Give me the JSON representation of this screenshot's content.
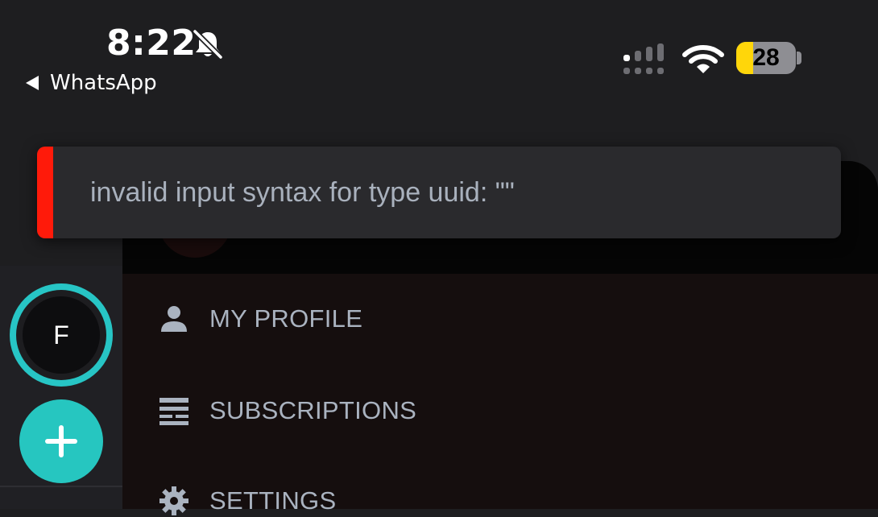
{
  "status_bar": {
    "time": "8:22",
    "back_label": "WhatsApp",
    "battery_level": "28",
    "battery_fraction": 0.28,
    "icons": [
      "bell-muted-icon",
      "signal-icon",
      "wifi-icon",
      "battery-icon"
    ]
  },
  "toast": {
    "message": "invalid input syntax for type uuid: \"\"",
    "accent_color": "#ff1a0a"
  },
  "rail": {
    "avatar_initial": "F",
    "ring_color": "#27c5c5",
    "add_button_icon": "plus-icon",
    "add_button_color": "#26c6c0"
  },
  "menu": {
    "items": [
      {
        "label": "MY PROFILE",
        "icon": "person-icon"
      },
      {
        "label": "SUBSCRIPTIONS",
        "icon": "subscriptions-icon"
      },
      {
        "label": "SETTINGS",
        "icon": "gear-icon"
      }
    ]
  }
}
